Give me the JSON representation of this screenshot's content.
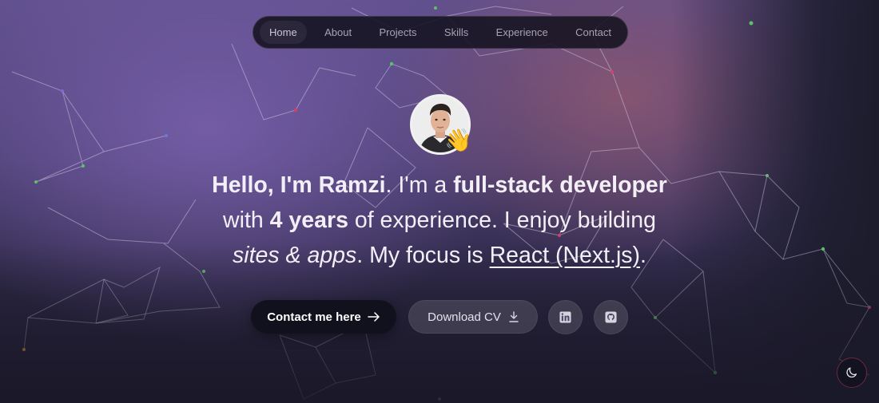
{
  "nav": {
    "items": [
      {
        "label": "Home",
        "active": true
      },
      {
        "label": "About",
        "active": false
      },
      {
        "label": "Projects",
        "active": false
      },
      {
        "label": "Skills",
        "active": false
      },
      {
        "label": "Experience",
        "active": false
      },
      {
        "label": "Contact",
        "active": false
      }
    ]
  },
  "hero": {
    "wave_emoji": "👋",
    "headline": {
      "hello": "Hello, I'm Ramzi",
      "im_a": ". I'm a ",
      "role": "full-stack developer",
      "with": "with ",
      "years": "4 years",
      "of_exp": " of experience. I enjoy building",
      "sites": "sites & apps",
      "focus": ". My focus is ",
      "tech": "React (Next.js)",
      "end": "."
    }
  },
  "buttons": {
    "contact_label": "Contact me here",
    "contact_icon": "arrow-right-icon",
    "cv_label": "Download CV",
    "cv_icon": "download-icon",
    "linkedin_icon": "linkedin-icon",
    "github_icon": "github-icon",
    "theme_icon": "moon-icon"
  },
  "colors": {
    "background_purple": "#5f4f8c",
    "accent_rose": "#965a6e",
    "button_dark": "#11111d",
    "text_light": "#f2eff7"
  }
}
